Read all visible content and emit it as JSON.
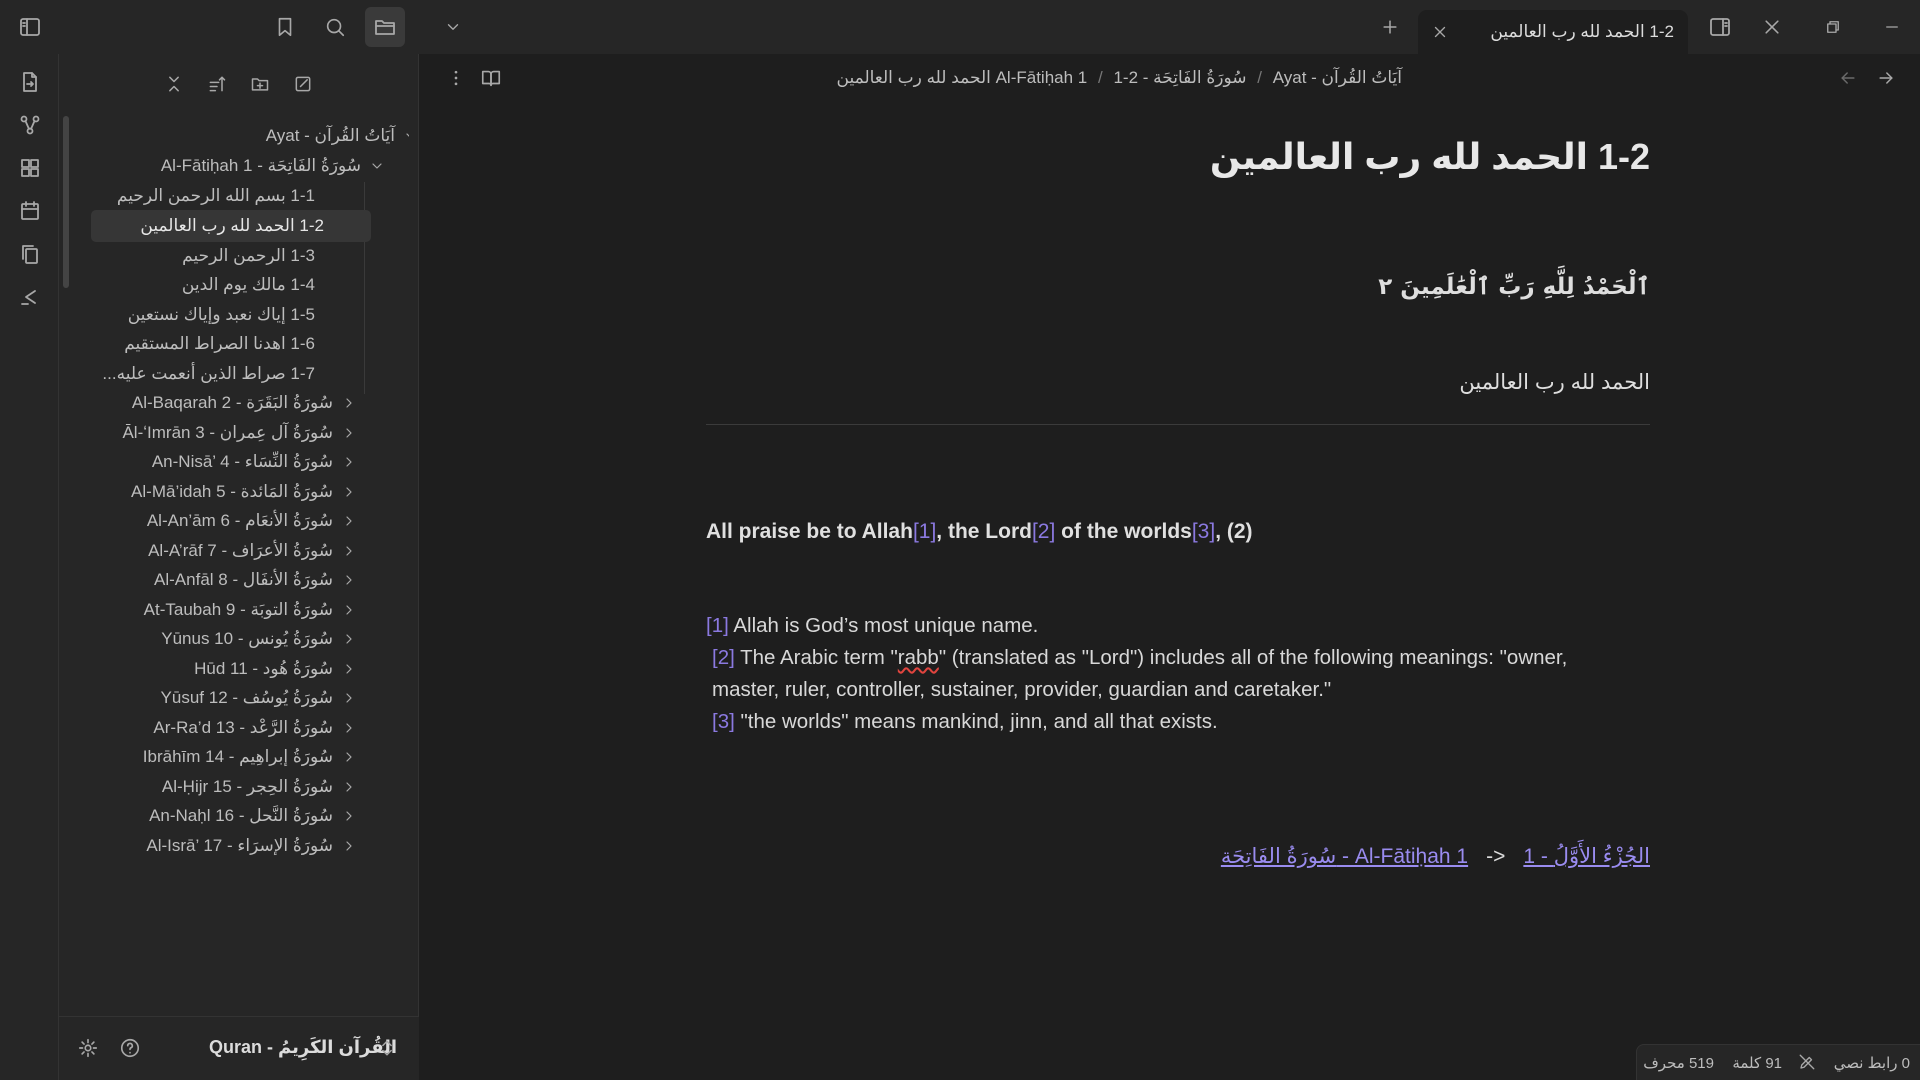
{
  "tab": {
    "title": "1-2 الحمد لله رب العالمين"
  },
  "breadcrumb": {
    "parts": [
      "آيَاتُ القُرآن - Ayat",
      "سُورَةُ الفَاتِحَة - Al-Fātiḥah 1",
      "1-2 الحمد لله رب العالمين"
    ],
    "separator": "/"
  },
  "tree": {
    "root": "آيَاتُ القُرآن - Ayat",
    "surah1": "سُورَةُ الفَاتِحَة - Al-Fātiḥah 1",
    "verses": [
      "1-1 بسم الله الرحمن الرحيم",
      "1-2 الحمد لله رب العالمين",
      "1-3 الرحمن الرحيم",
      "1-4 مالك يوم الدين",
      "1-5 إياك نعبد وإياك نستعين",
      "1-6 اهدنا الصراط المستقيم",
      "1-7 صراط الذين أنعمت عليه..."
    ],
    "surahs": [
      "سُورَةُ البَقَرَة - Al-Baqarah 2",
      "سُورَةُ آل عِمران - Āl-ʻImrān 3",
      "سُورَةُ النِّسَاء - An-Nisā’ 4",
      "سُورَةُ المَائدة - Al-Mā’idah 5",
      "سُورَةُ الأنعَام - Al-An’ām 6",
      "سُورَةُ الأعرَاف - Al-A’rāf 7",
      "سُورَةُ الأنفَال - Al-Anfāl 8",
      "سُورَةُ التوبَة - At-Taubah 9",
      "سُورَةُ يُونس - Yūnus 10",
      "سُورَةُ هُود - Hūd 11",
      "سُورَةُ يُوسُف - Yūsuf 12",
      "سُورَةُ الرَّعْد - Ar-Ra’d 13",
      "سُورَةُ إبراهِيم - Ibrāhīm 14",
      "سُورَةُ الحِجر - Al-Ḥijr 15",
      "سُورَةُ النَّحل - An-Naḥl 16",
      "سُورَةُ الإسرَاء - Al-Isrā’ 17"
    ]
  },
  "vault": {
    "name": "القُرآن الكَرِيمُ - Quran"
  },
  "note": {
    "title": "1-2 الحمد لله رب العالمين",
    "arabic_verse": "ٱلْحَمْدُ لِلَّهِ رَبِّ ٱلْعَٰلَمِينَ ٢",
    "arabic_plain": "الحمد لله رب العالمين",
    "translation": {
      "t1": "All praise be to Allah",
      "r1": "[1]",
      "t2": ", the Lord",
      "r2": "[2]",
      "t3": " of the worlds",
      "r3": "[3]",
      "t4": ", (2)"
    },
    "footnotes": {
      "n1": "[1]",
      "f1": " Allah is God’s most unique name.",
      "n2": "[2]",
      "f2a": " The Arabic term \"",
      "f2b": "rabb",
      "f2c": "\" (translated as \"Lord\") includes all of the following meanings: \"owner,",
      "f2d": "master, ruler, controller, sustainer, provider, guardian and caretaker.\"",
      "n3": "[3]",
      "f3": " \"the worlds\" means mankind, jinn, and all that exists."
    },
    "nav": {
      "juz_link": "1 - الجُزْءُ الأَوَّلُ",
      "arrow": "->",
      "surah_link": "سُورَةُ الفَاتِحَة - Al-Fātiḥah 1"
    }
  },
  "status": {
    "backlinks": "0 رابط نصي",
    "words": "91 كلمة",
    "chars": "519 محرف"
  }
}
